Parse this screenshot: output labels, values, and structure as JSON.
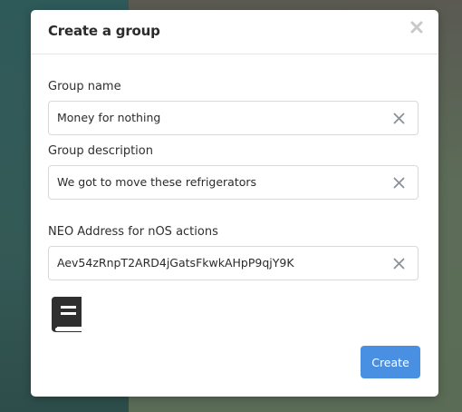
{
  "modal": {
    "title": "Create a group",
    "close_icon": "close-x-icon"
  },
  "fields": {
    "group_name": {
      "label": "Group name",
      "value": "Money for nothing"
    },
    "group_description": {
      "label": "Group description",
      "value": "We got to move these refrigerators"
    },
    "neo_address": {
      "label": "NEO Address for nOS actions",
      "value": "Aev54zRnpT2ARD4jGatsFkwkAHpP9qjY9K"
    }
  },
  "icons": {
    "clear": "clear-x-icon",
    "book": "book-icon"
  },
  "actions": {
    "create_label": "Create"
  },
  "colors": {
    "primary_button": "#4a90e2",
    "clear_icon": "#8a9199",
    "book_icon": "#2f2f2f"
  }
}
